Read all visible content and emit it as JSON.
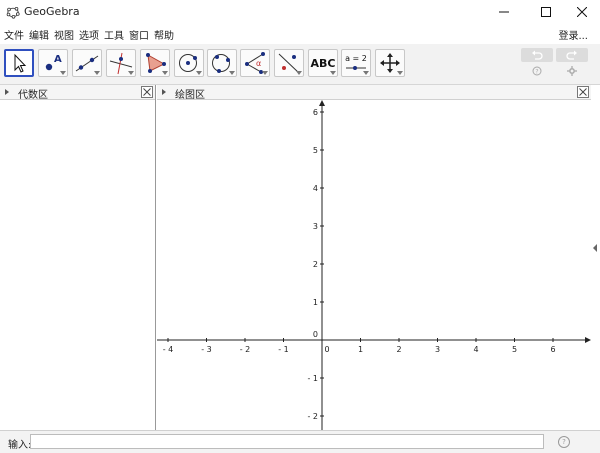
{
  "window": {
    "title": "GeoGebra",
    "controls": [
      "minimize-icon",
      "maximize-icon",
      "close-icon"
    ]
  },
  "menu": {
    "items": [
      "文件",
      "编辑",
      "视图",
      "选项",
      "工具",
      "窗口",
      "帮助"
    ],
    "login": "登录..."
  },
  "toolbar": {
    "tools": [
      {
        "name": "move",
        "icon": "move-arrow-icon",
        "selected": true
      },
      {
        "name": "point",
        "icon": "point-icon",
        "label": "A"
      },
      {
        "name": "line",
        "icon": "line-icon"
      },
      {
        "name": "perpendicular-line",
        "icon": "perpendicular-line-icon"
      },
      {
        "name": "polygon",
        "icon": "polygon-icon"
      },
      {
        "name": "circle-center-point",
        "icon": "circle-icon"
      },
      {
        "name": "circle-three-points",
        "icon": "circle-three-points-icon"
      },
      {
        "name": "angle",
        "icon": "angle-icon",
        "label": "α"
      },
      {
        "name": "reflect",
        "icon": "reflect-icon"
      },
      {
        "name": "text",
        "icon": "text-icon",
        "label": "ABC"
      },
      {
        "name": "slider",
        "icon": "slider-icon",
        "label": "a = 2"
      },
      {
        "name": "move-graphics",
        "icon": "move-graphics-icon"
      }
    ],
    "undo_icon": "undo-icon",
    "redo_icon": "redo-icon",
    "help_icon": "help-icon",
    "settings_icon": "gear-icon"
  },
  "algebra": {
    "title": "代数区"
  },
  "graphics": {
    "title": "绘图区",
    "x_ticks": [
      "- 4",
      "- 3",
      "- 2",
      "- 1",
      "0",
      "1",
      "2",
      "3",
      "4",
      "5",
      "6"
    ],
    "y_ticks": [
      "6",
      "5",
      "4",
      "3",
      "2",
      "1",
      "0",
      "- 1",
      "- 2"
    ]
  },
  "input": {
    "label": "输入:",
    "value": "",
    "placeholder": ""
  }
}
